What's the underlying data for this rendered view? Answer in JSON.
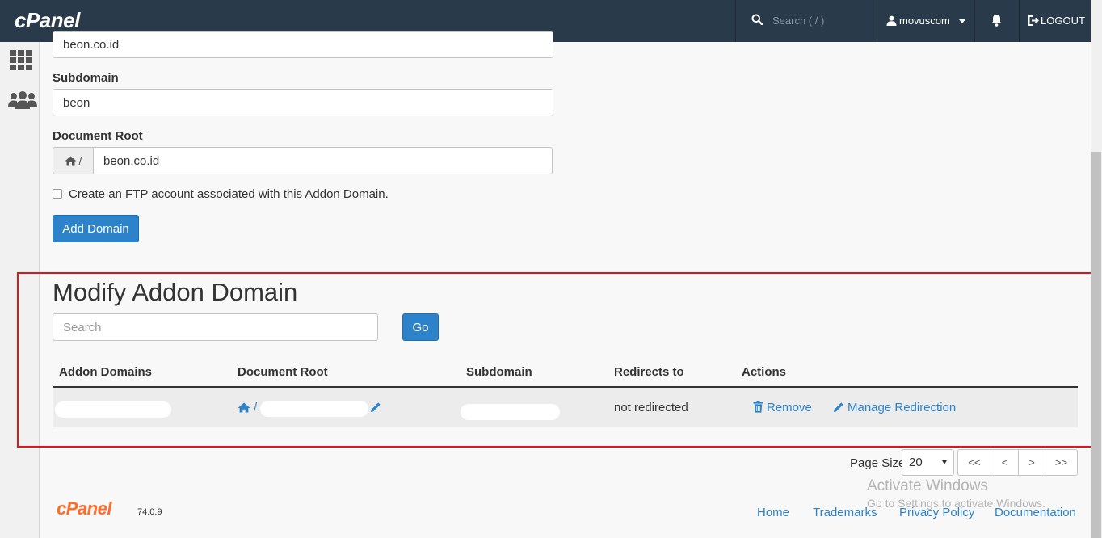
{
  "topbar": {
    "brand": "cPanel",
    "search_placeholder": "Search ( / )",
    "username": "movuscom",
    "logout_label": "LOGOUT"
  },
  "form": {
    "domain_value": "beon.co.id",
    "subdomain_label": "Subdomain",
    "subdomain_value": "beon",
    "docroot_label": "Document Root",
    "docroot_prefix": "/",
    "docroot_value": "beon.co.id",
    "ftp_label": "Create an FTP account associated with this Addon Domain.",
    "add_button": "Add Domain"
  },
  "modify": {
    "title": "Modify Addon Domain",
    "search_placeholder": "Search",
    "go_button": "Go",
    "columns": [
      "Addon Domains",
      "Document Root",
      "Subdomain",
      "Redirects to",
      "Actions"
    ],
    "rows": [
      {
        "docroot_prefix": "/",
        "redirects_to": "not redirected",
        "remove_label": "Remove",
        "manage_label": "Manage Redirection"
      }
    ]
  },
  "pagination": {
    "page_size_label": "Page Size",
    "page_size_value": "20",
    "buttons": [
      "<<",
      "<",
      ">",
      ">>"
    ]
  },
  "footer": {
    "logo": "cPanel",
    "version": "74.0.9",
    "links": [
      "Home",
      "Trademarks",
      "Privacy Policy",
      "Documentation"
    ]
  },
  "watermark": {
    "line1": "Activate Windows",
    "line2": "Go to Settings to activate Windows."
  },
  "colors": {
    "topbar": "#293a4a",
    "primary": "#2c83c9",
    "highlight": "#e0141a",
    "footer_logo": "#ff6c2c"
  }
}
